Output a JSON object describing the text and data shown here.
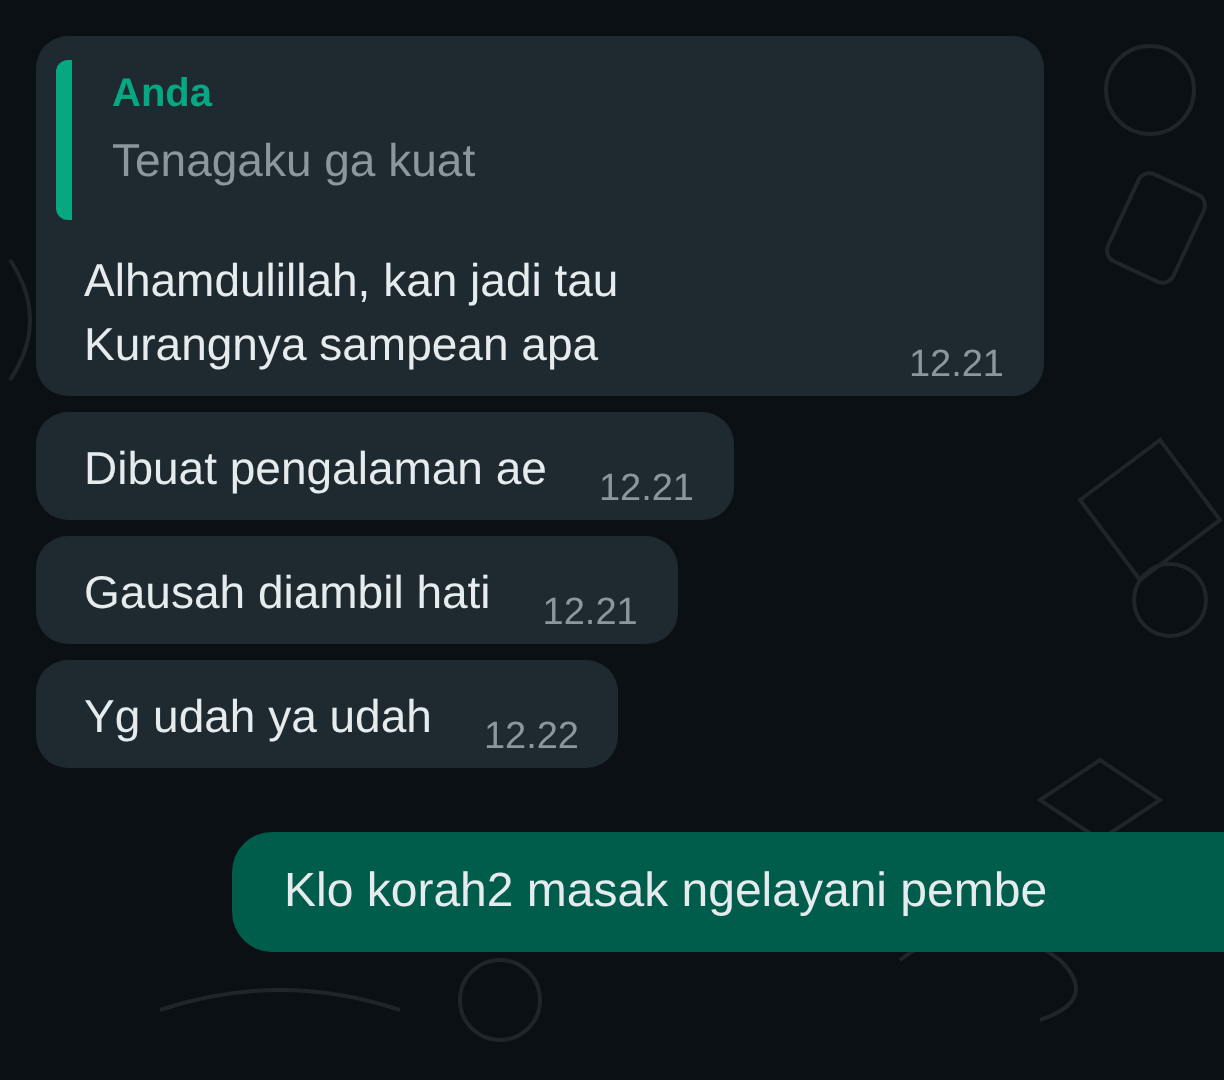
{
  "messages": [
    {
      "kind": "incoming",
      "quote": {
        "author": "Anda",
        "text": "Tenagaku ga kuat"
      },
      "lines": [
        "Alhamdulillah, kan jadi tau",
        "Kurangnya sampean apa"
      ],
      "time": "12.21"
    },
    {
      "kind": "incoming",
      "lines": [
        "Dibuat pengalaman ae"
      ],
      "time": "12.21"
    },
    {
      "kind": "incoming",
      "lines": [
        "Gausah diambil hati"
      ],
      "time": "12.21"
    },
    {
      "kind": "incoming",
      "lines": [
        "Yg udah ya udah"
      ],
      "time": "12.22"
    },
    {
      "kind": "outgoing",
      "lines": [
        "Klo korah2 masak ngelayani pembe"
      ]
    }
  ]
}
